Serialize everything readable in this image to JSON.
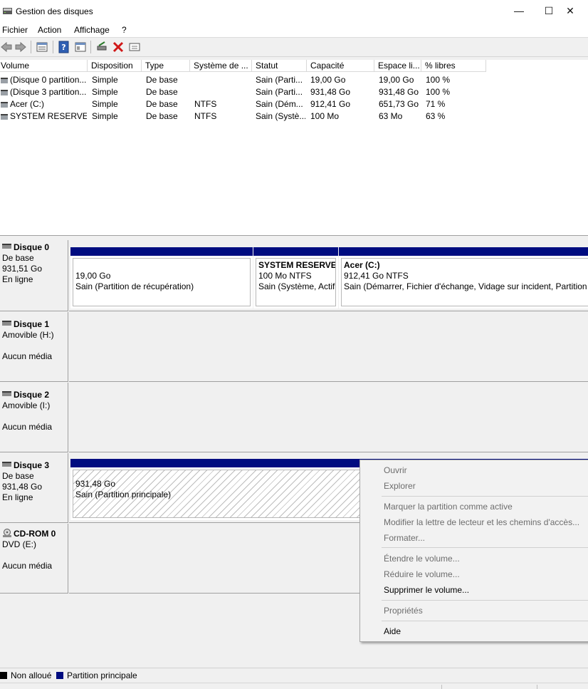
{
  "window": {
    "title": "Gestion des disques",
    "minimize": "—",
    "maximize": "☐",
    "close": "✕"
  },
  "menu": [
    "Fichier",
    "Action",
    "Affichage",
    "?"
  ],
  "toolbar": {
    "icons": [
      "back-arrow-icon",
      "forward-arrow-icon",
      "list-view-icon",
      "help-icon",
      "properties-icon",
      "connect-disk-icon",
      "delete-icon",
      "check-icon"
    ]
  },
  "volume_list": {
    "columns": [
      "Volume",
      "Disposition",
      "Type",
      "Système de ...",
      "Statut",
      "Capacité",
      "Espace li...",
      "% libres"
    ],
    "rows": [
      [
        "(Disque 0 partition...",
        "Simple",
        "De base",
        "",
        "Sain (Parti...",
        "19,00 Go",
        "19,00 Go",
        "100 %"
      ],
      [
        "(Disque 3 partition...",
        "Simple",
        "De base",
        "",
        "Sain (Parti...",
        "931,48 Go",
        "931,48 Go",
        "100 %"
      ],
      [
        "Acer (C:)",
        "Simple",
        "De base",
        "NTFS",
        "Sain (Dém...",
        "912,41 Go",
        "651,73 Go",
        "71 %"
      ],
      [
        "SYSTEM RESERVED",
        "Simple",
        "De base",
        "NTFS",
        "Sain (Systè...",
        "100 Mo",
        "63 Mo",
        "63 %"
      ]
    ]
  },
  "disks": {
    "d0": {
      "name": "Disque 0",
      "type": "De base",
      "size": "931,51 Go",
      "state": "En ligne",
      "p1": {
        "line1": "19,00 Go",
        "line2": "Sain (Partition de récupération)"
      },
      "p2": {
        "title": "SYSTEM RESERVED",
        "line1": "100 Mo NTFS",
        "line2": "Sain (Système, Actif"
      },
      "p3": {
        "title": "Acer  (C:)",
        "line1": "912,41 Go NTFS",
        "line2": "Sain (Démarrer, Fichier d'échange, Vidage sur incident, Partition p"
      }
    },
    "d1": {
      "name": "Disque 1",
      "type": "Amovible (H:)",
      "state": "Aucun média"
    },
    "d2": {
      "name": "Disque 2",
      "type": "Amovible (I:)",
      "state": "Aucun média"
    },
    "d3": {
      "name": "Disque 3",
      "type": "De base",
      "size": "931,48 Go",
      "state": "En ligne",
      "p1": {
        "line1": "931,48 Go",
        "line2": "Sain (Partition principale)"
      }
    },
    "cd": {
      "name": "CD-ROM 0",
      "type": "DVD (E:)",
      "state": "Aucun média"
    }
  },
  "context_menu": {
    "open": "Ouvrir",
    "explore": "Explorer",
    "mark_active": "Marquer la partition comme active",
    "change_letter": "Modifier la lettre de lecteur et les chemins d'accès...",
    "format": "Formater...",
    "extend": "Étendre le volume...",
    "shrink": "Réduire le volume...",
    "delete": "Supprimer le volume...",
    "properties": "Propriétés",
    "help": "Aide"
  },
  "legend": {
    "unallocated": "Non alloué",
    "primary": "Partition principale",
    "colors": {
      "unallocated": "#000000",
      "primary": "#000c80"
    }
  }
}
